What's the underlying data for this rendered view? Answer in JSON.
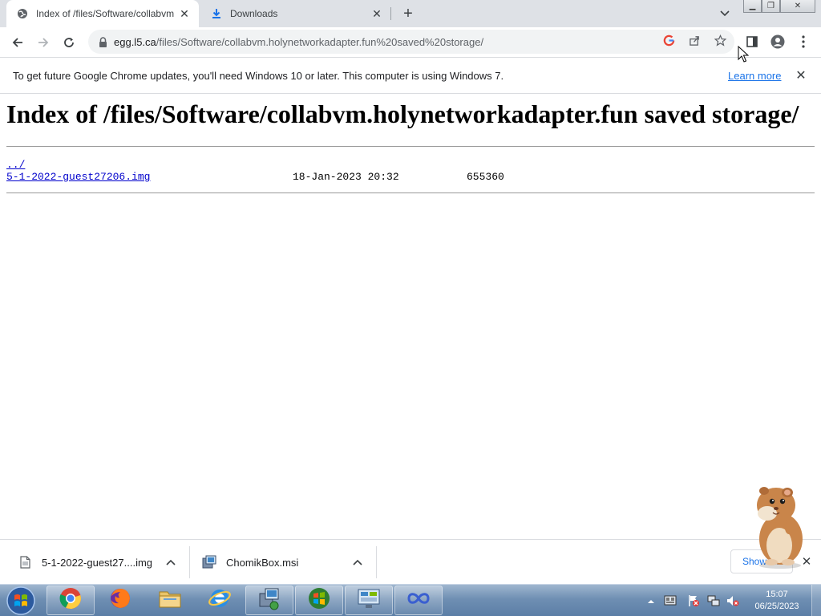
{
  "browser": {
    "tabs": [
      {
        "title": "Index of /files/Software/collabvm",
        "active": true,
        "icon": "globe-icon"
      },
      {
        "title": "Downloads",
        "active": false,
        "icon": "download-icon"
      }
    ],
    "url": {
      "host": "egg.l5.ca",
      "path": "/files/Software/collabvm.holynetworkadapter.fun%20saved%20storage/"
    }
  },
  "infobar": {
    "message": "To get future Google Chrome updates, you'll need Windows 10 or later. This computer is using Windows 7.",
    "link": "Learn more"
  },
  "page": {
    "heading": "Index of /files/Software/collabvm.holynetworkadapter.fun saved storage/",
    "parent_link": "../",
    "entries": [
      {
        "name": "5-1-2022-guest27206.img",
        "date": "18-Jan-2023 20:32",
        "size": "655360"
      }
    ]
  },
  "downloads": {
    "items": [
      {
        "name": "5-1-2022-guest27....img",
        "icon": "file-icon"
      },
      {
        "name": "ChomikBox.msi",
        "icon": "installer-icon"
      }
    ],
    "show_all": "Show all"
  },
  "taskbar": {
    "pinned": [
      "chrome-icon",
      "firefox-icon",
      "explorer-icon",
      "ie-icon",
      "setup-icon",
      "windows-icon",
      "control-panel-icon",
      "infinity-icon"
    ],
    "clock_time": "15:07",
    "clock_date": "06/25/2023"
  },
  "colors": {
    "accent": "#1a73e8",
    "taskbar": "#6f8fb3",
    "link": "#0000cc"
  }
}
